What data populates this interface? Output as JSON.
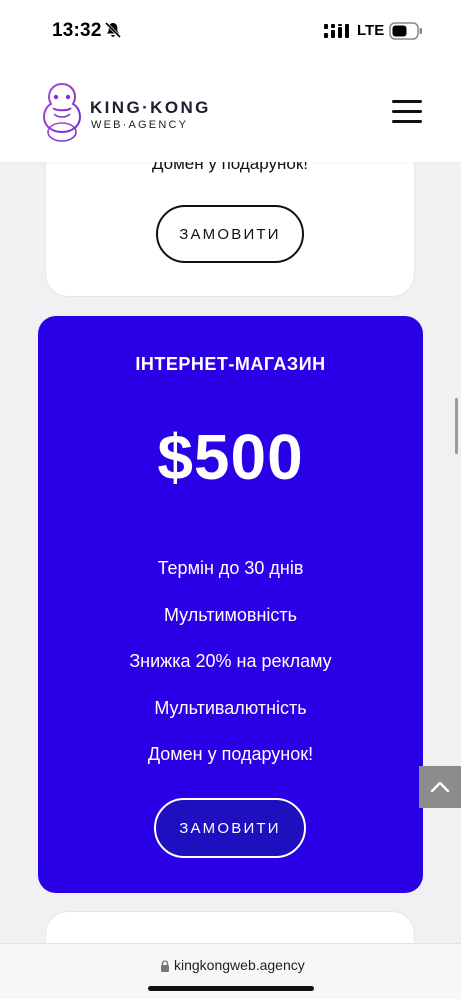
{
  "status_bar": {
    "time": "13:32",
    "network": "LTE",
    "icons": [
      "bell-slash-icon",
      "signal-icon",
      "battery-icon"
    ]
  },
  "header": {
    "logo_title": "KING·KONG",
    "logo_subtitle": "WEB·AGENCY",
    "menu_icon": "hamburger-menu-icon"
  },
  "top_card": {
    "last_feature": "Домен у подарунок!",
    "order_label": "ЗАМОВИТИ"
  },
  "plan_card": {
    "title": "ІНТЕРНЕТ-МАГАЗИН",
    "price": "$500",
    "features": [
      "Термін до 30 днів",
      "Мультимовність",
      "Знижка 20% на рекламу",
      "Мультивалютність",
      "Домен у подарунок!"
    ],
    "order_label": "ЗАМОВИТИ",
    "background_color": "#2a00e6"
  },
  "scroll_top": {
    "icon": "chevron-up-icon"
  },
  "url_bar": {
    "url": "kingkongweb.agency",
    "icon": "lock-icon"
  }
}
